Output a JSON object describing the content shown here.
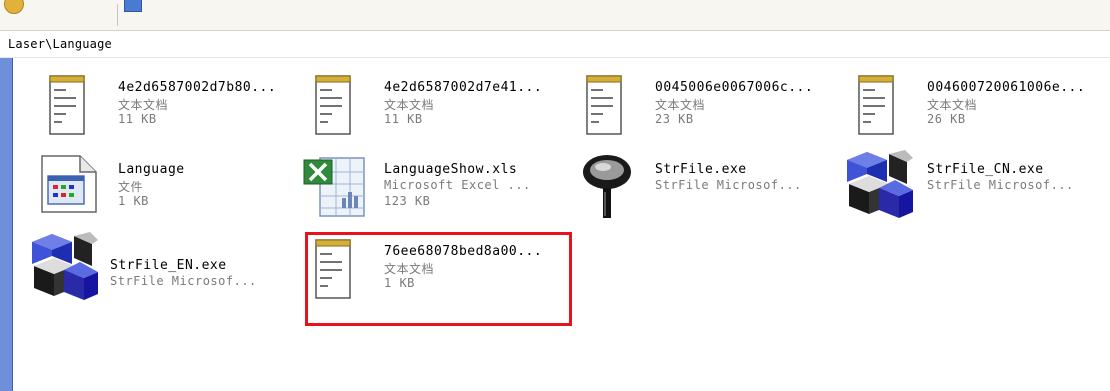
{
  "address": {
    "path": "Laser\\Language"
  },
  "files": [
    {
      "name": "4e2d6587002d7b80...",
      "type": "文本文档",
      "size": "11 KB",
      "icon": "notepad-text-icon"
    },
    {
      "name": "4e2d6587002d7e41...",
      "type": "文本文档",
      "size": "11 KB",
      "icon": "notepad-text-icon"
    },
    {
      "name": "0045006e0067006c...",
      "type": "文本文档",
      "size": "23 KB",
      "icon": "notepad-text-icon"
    },
    {
      "name": "004600720061006e...",
      "type": "文本文档",
      "size": "26 KB",
      "icon": "notepad-text-icon"
    },
    {
      "name": "Language",
      "type": "文件",
      "size": "1 KB",
      "icon": "generic-file-icon"
    },
    {
      "name": "LanguageShow.xls",
      "type": "Microsoft Excel ...",
      "size": "123 KB",
      "icon": "excel-file-icon"
    },
    {
      "name": "StrFile.exe",
      "type": "StrFile Microsof...",
      "size": "",
      "icon": "magnifier-exe-icon"
    },
    {
      "name": "StrFile_CN.exe",
      "type": "StrFile Microsof...",
      "size": "",
      "icon": "mfc-exe-icon"
    },
    {
      "name": "StrFile_EN.exe",
      "type": "StrFile Microsof...",
      "size": "",
      "icon": "mfc-exe-icon"
    },
    {
      "name": "76ee68078bed8a00...",
      "type": "文本文档",
      "size": "1 KB",
      "icon": "notepad-text-icon"
    }
  ],
  "highlight": {
    "color": "#e8121c",
    "item_index": 9
  }
}
